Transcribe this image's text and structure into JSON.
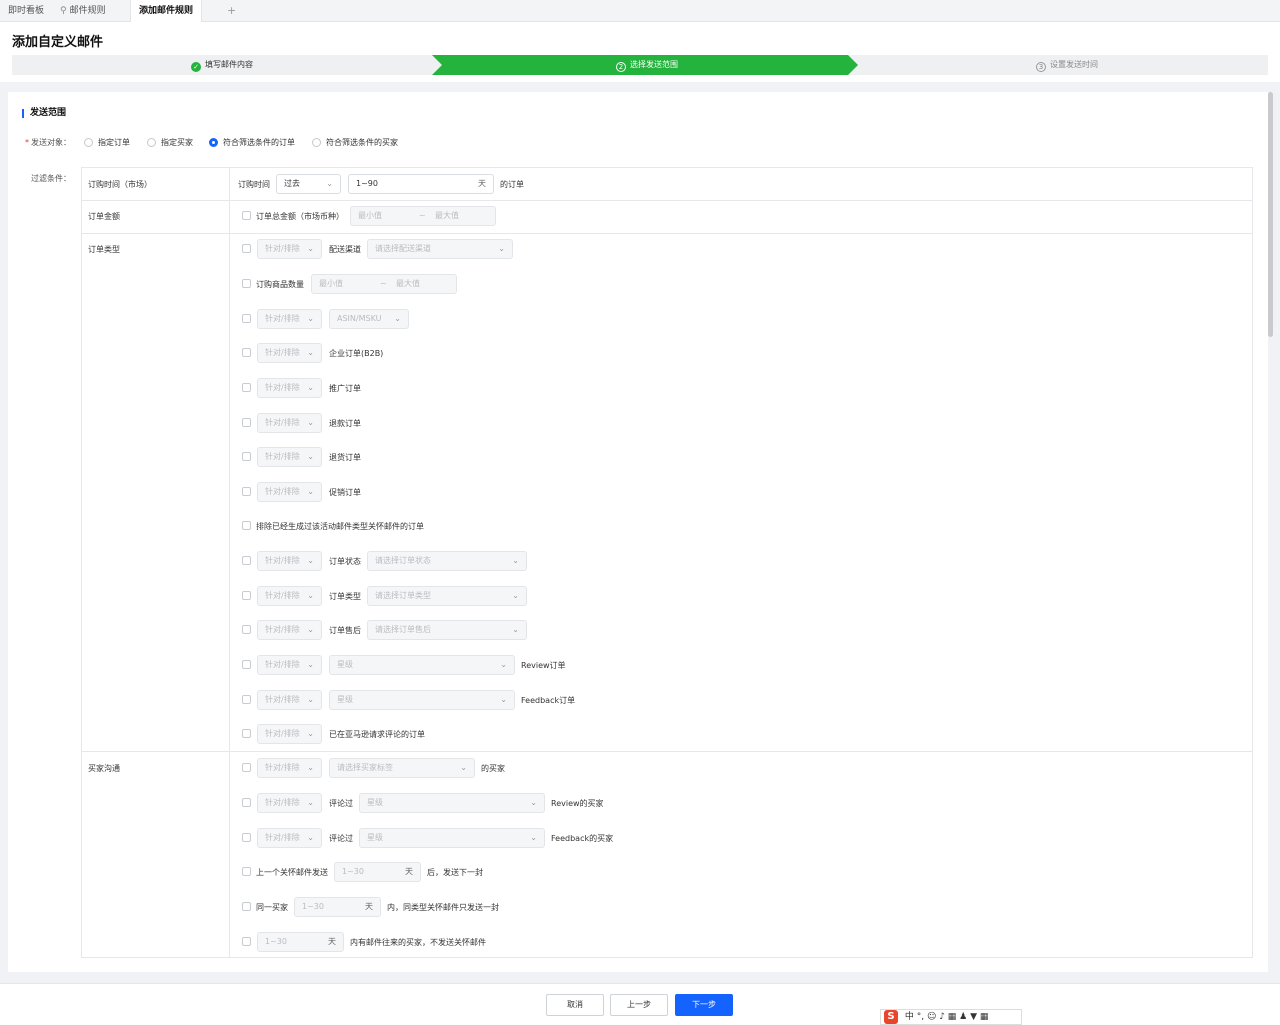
{
  "tabs": [
    {
      "label": "即时看板",
      "icon": null
    },
    {
      "label": "邮件规则",
      "icon": "pin-icon"
    },
    {
      "label": "添加邮件规则",
      "icon": null
    }
  ],
  "tab_add": "+",
  "page_title": "添加自定义邮件",
  "steps": [
    {
      "num": "✓",
      "label": "填写邮件内容",
      "state": "done"
    },
    {
      "num": "2",
      "label": "选择发送范围",
      "state": "active"
    },
    {
      "num": "3",
      "label": "设置发送时间",
      "state": "pending"
    }
  ],
  "colors": {
    "accent": "#1463ff",
    "step_active": "#24b33d"
  },
  "section_title": "发送范围",
  "target": {
    "label": "发送对象：",
    "required_mark": "*",
    "options": [
      "指定订单",
      "指定买家",
      "符合筛选条件的订单",
      "符合筛选条件的买家"
    ],
    "selected": "符合筛选条件的订单"
  },
  "filter_label": "过滤条件：",
  "rows": {
    "order_time": "订购时间（市场）",
    "order_amount": "订单金额",
    "order_type": "订单类型",
    "buyer_comm": "买家沟通"
  },
  "order_time": {
    "prefix": "订购时间",
    "select": "过去",
    "range": "1~90",
    "unit": "天",
    "suffix": "的订单"
  },
  "order_amount": {
    "label": "订单总金额（市场币种）",
    "min_ph": "最小值",
    "tilde": "~",
    "max_ph": "最大值"
  },
  "include_exclude": "针对/排除",
  "order_type_items": {
    "channel_label": "配送渠道",
    "channel_ph": "请选择配送渠道",
    "qty_label": "订购商品数量",
    "qty_min": "最小值",
    "qty_tilde": "~",
    "qty_max": "最大值",
    "asin": "ASIN/MSKU",
    "b2b": "企业订单(B2B)",
    "promo": "推广订单",
    "refund": "退款订单",
    "return": "退货订单",
    "promotion": "促销订单",
    "exclude_care": "排除已经生成过该活动邮件类型关怀邮件的订单",
    "status_label": "订单状态",
    "status_ph": "请选择订单状态",
    "type_label": "订单类型",
    "type_ph": "请选择订单类型",
    "aftersale_label": "订单售后",
    "aftersale_ph": "请选择订单售后",
    "star_ph": "星级",
    "review_order": "Review订单",
    "feedback_order": "Feedback订单",
    "requested_review": "已在亚马逊请求评论的订单"
  },
  "buyer_items": {
    "tag_ph": "请选择买家标签",
    "buyer_suffix": "的买家",
    "reviewed_label": "评论过",
    "star_ph": "星级",
    "review_buyer": "Review的买家",
    "feedback_buyer": "Feedback的买家",
    "last_care_label": "上一个关怀邮件发送",
    "last_care_range": "1~30",
    "last_care_unit": "天",
    "last_care_suffix": "后，发送下一封",
    "same_buyer_label": "同一买家",
    "same_buyer_range": "1~30",
    "same_buyer_unit": "天",
    "same_buyer_suffix": "内，同类型关怀邮件只发送一封",
    "recent_range": "1~30",
    "recent_unit": "天",
    "recent_suffix": "内有邮件往来的买家，不发送关怀邮件"
  },
  "footer": {
    "cancel": "取消",
    "prev": "上一步",
    "next": "下一步"
  },
  "ime": {
    "logo": "S",
    "text": "中 °, ☺ ♪ ▦ ♟ ▼ ▦"
  }
}
